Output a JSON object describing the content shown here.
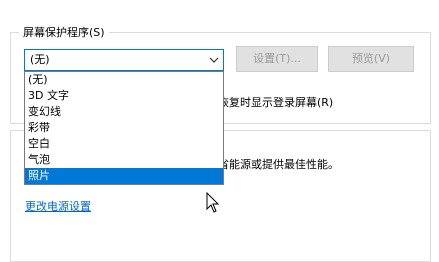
{
  "screensaver": {
    "group_title": "屏幕保护程序(S)",
    "selected_value": "(无)",
    "settings_button": "设置(T)...",
    "preview_button": "预览(V)",
    "options": [
      "(无)",
      "3D 文字",
      "变幻线",
      "彩带",
      "空白",
      "气泡",
      "照片"
    ],
    "highlighted_option": "照片"
  },
  "behind": {
    "resume_text": "恢复时显示登录屏幕(R)",
    "power_text": "省能源或提供最佳性能。",
    "power_link": "更改电源设置"
  },
  "colors": {
    "accent": "#0078d7",
    "link": "#0066cc"
  }
}
